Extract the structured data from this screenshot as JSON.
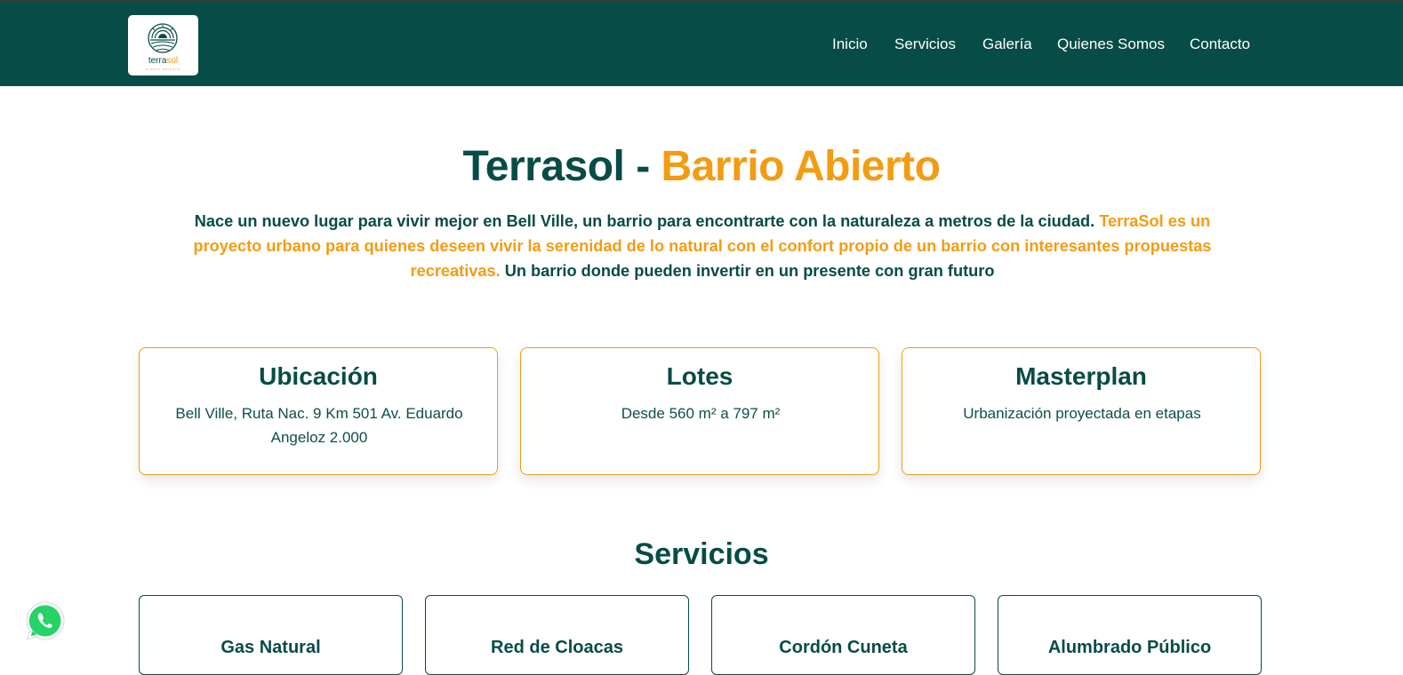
{
  "header": {
    "logo": {
      "word_main": "terra",
      "word_accent": "sol",
      "tagline": "BARRIO ABIERTO"
    },
    "nav": [
      {
        "label": "Inicio"
      },
      {
        "label": "Servicios"
      },
      {
        "label": "Galería"
      },
      {
        "label": "Quienes Somos"
      },
      {
        "label": "Contacto"
      }
    ]
  },
  "hero": {
    "title_main": "Terrasol -",
    "title_accent": "Barrio Abierto",
    "text_part1": "Nace un nuevo lugar para vivir mejor en Bell Ville, un barrio para encontrarte con la naturaleza a metros de la ciudad.",
    "text_highlight": "TerraSol es un proyecto urbano para quienes deseen vivir la serenidad de lo natural con el confort propio de un barrio con interesantes propuestas recreativas.",
    "text_part2": "Un barrio donde pueden invertir en un presente con gran futuro"
  },
  "info_cards": [
    {
      "title": "Ubicación",
      "text": "Bell Ville, Ruta Nac. 9 Km 501 Av. Eduardo Angeloz 2.000"
    },
    {
      "title": "Lotes",
      "text": "Desde 560 m² a 797 m²"
    },
    {
      "title": "Masterplan",
      "text": "Urbanización proyectada en etapas"
    }
  ],
  "services": {
    "title": "Servicios",
    "items": [
      {
        "label": "Gas Natural"
      },
      {
        "label": "Red de Cloacas"
      },
      {
        "label": "Cordón Cuneta"
      },
      {
        "label": "Alumbrado Público"
      }
    ]
  },
  "icons": {
    "logo": "sun-field-logo-icon",
    "whatsapp": "whatsapp-icon"
  },
  "colors": {
    "brand_green": "#074c46",
    "accent_orange": "#f39c12",
    "whatsapp_green": "#25d366"
  }
}
